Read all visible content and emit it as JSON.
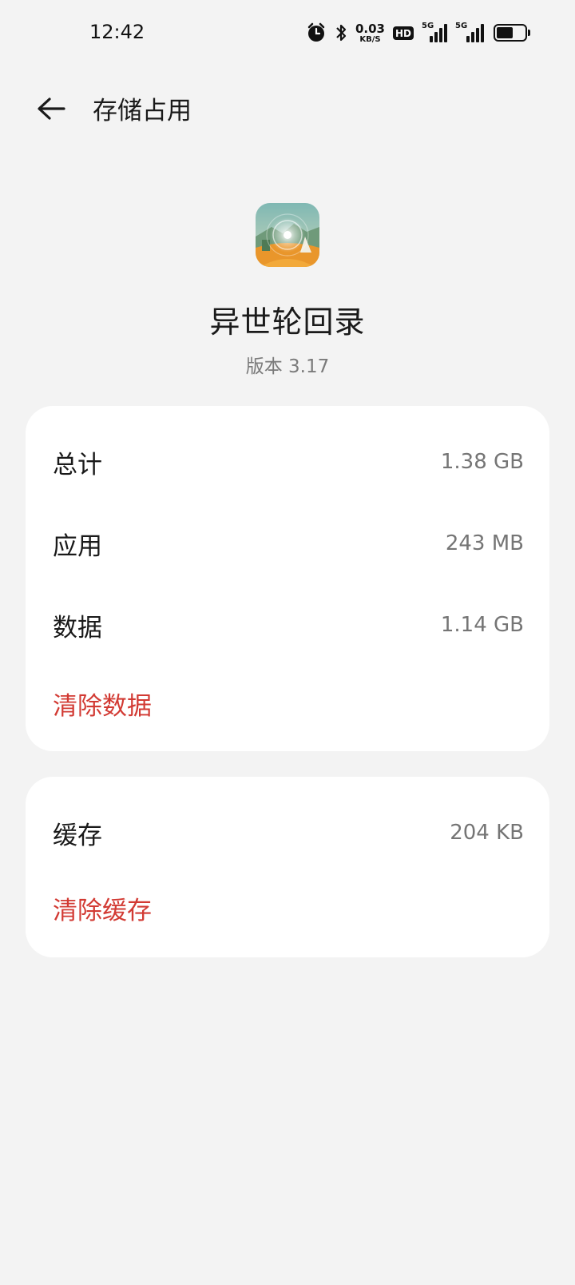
{
  "status_bar": {
    "time": "12:42",
    "net_speed_value": "0.03",
    "net_speed_unit": "KB/S",
    "hd_label": "HD",
    "signal_1_label": "5G",
    "signal_2_label": "5G",
    "battery_level": 0.6,
    "icons": [
      "alarm-icon",
      "bluetooth-icon",
      "hd-voice-icon",
      "signal-icon",
      "signal-icon",
      "battery-icon"
    ]
  },
  "app_bar": {
    "title": "存储占用"
  },
  "app": {
    "name": "异世轮回录",
    "version": "版本  3.17"
  },
  "storage": {
    "total_label": "总计",
    "total_value": "1.38 GB",
    "app_label": "应用",
    "app_value": "243 MB",
    "data_label": "数据",
    "data_value": "1.14 GB",
    "clear_data": "清除数据"
  },
  "cache": {
    "label": "缓存",
    "value": "204 KB",
    "clear_cache": "清除缓存"
  },
  "colors": {
    "background": "#f3f3f3",
    "card": "#ffffff",
    "accent_red": "#d23a33",
    "secondary_text": "#757575"
  }
}
